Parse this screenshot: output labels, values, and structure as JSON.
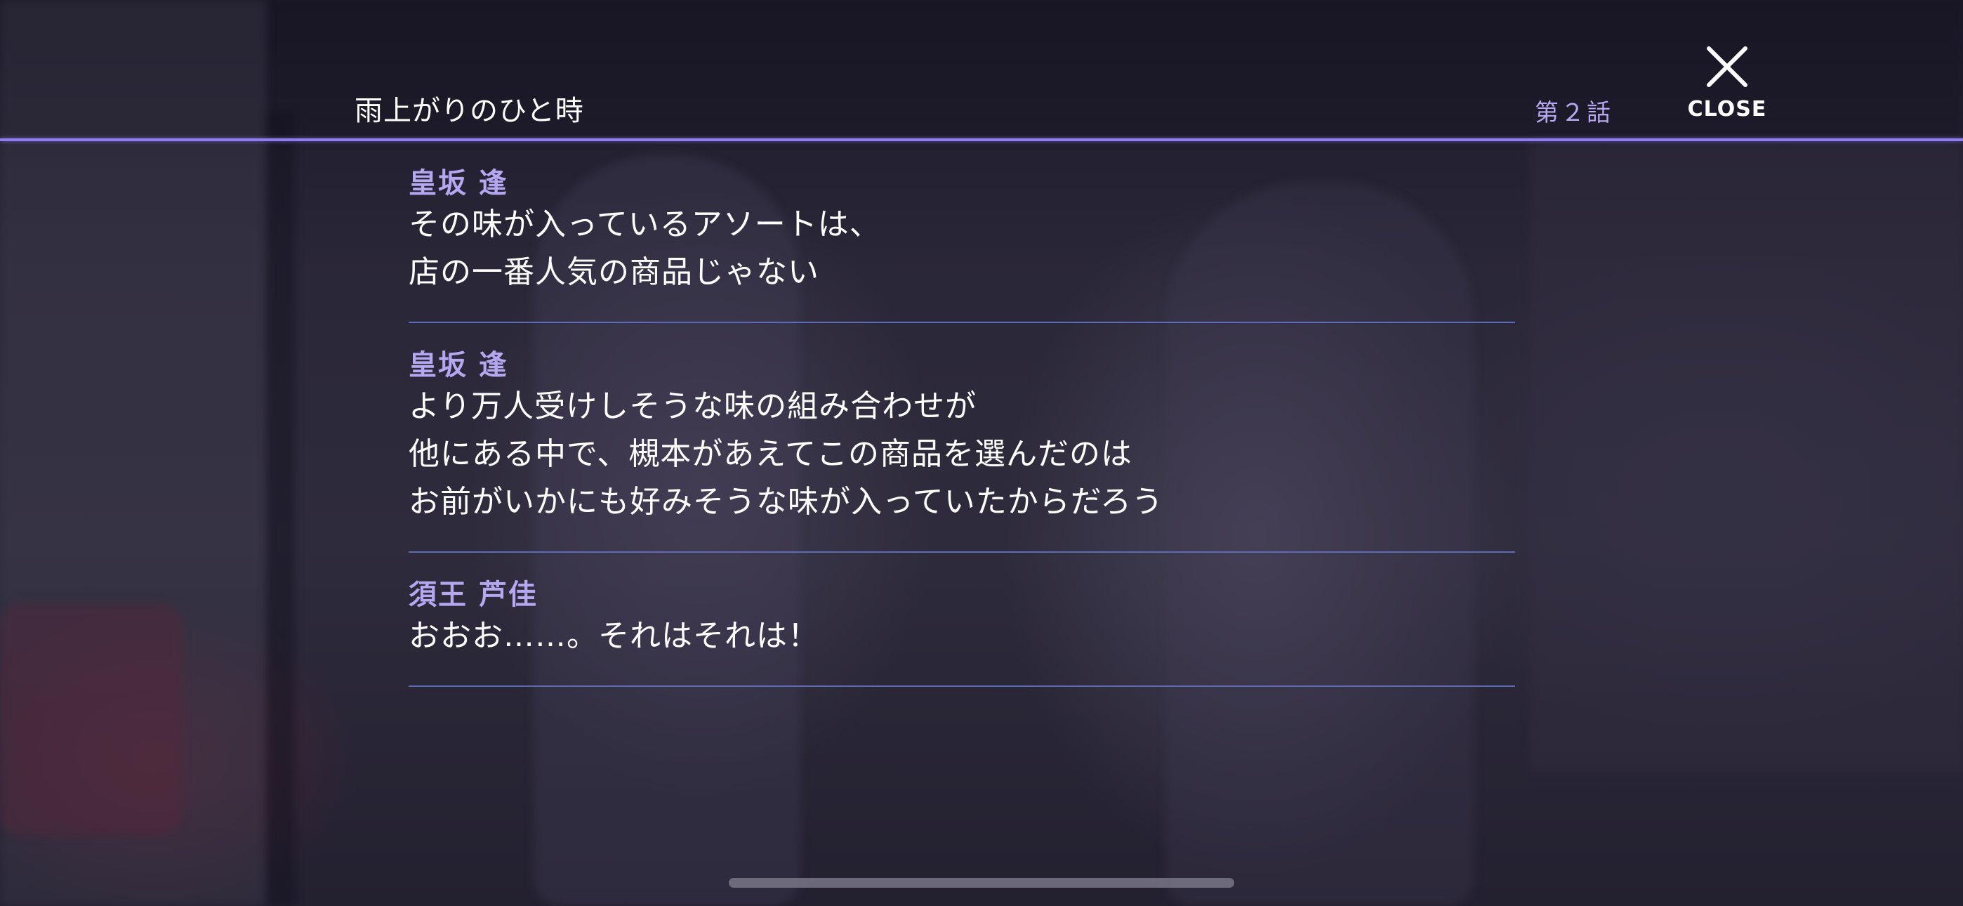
{
  "header": {
    "episode_title": "雨上がりのひと時",
    "chapter_label": "第２話",
    "close_label": "CLOSE",
    "close_icon": "close-icon"
  },
  "log": [
    {
      "speaker": "皇坂 逢",
      "lines": [
        "その味が入っているアソートは、",
        "店の一番人気の商品じゃない"
      ]
    },
    {
      "speaker": "皇坂 逢",
      "lines": [
        "より万人受けしそうな味の組み合わせが",
        "他にある中で、槻本があえてこの商品を選んだのは",
        "お前がいかにも好みそうな味が入っていたからだろう"
      ]
    },
    {
      "speaker": "須王 芦佳",
      "lines": [
        "おおお……。それはそれは！"
      ]
    }
  ],
  "colors": {
    "accent": "#8f7cf0",
    "speaker": "#b6a8f0",
    "divider": "#5c6bb8",
    "text": "#ffffff"
  }
}
